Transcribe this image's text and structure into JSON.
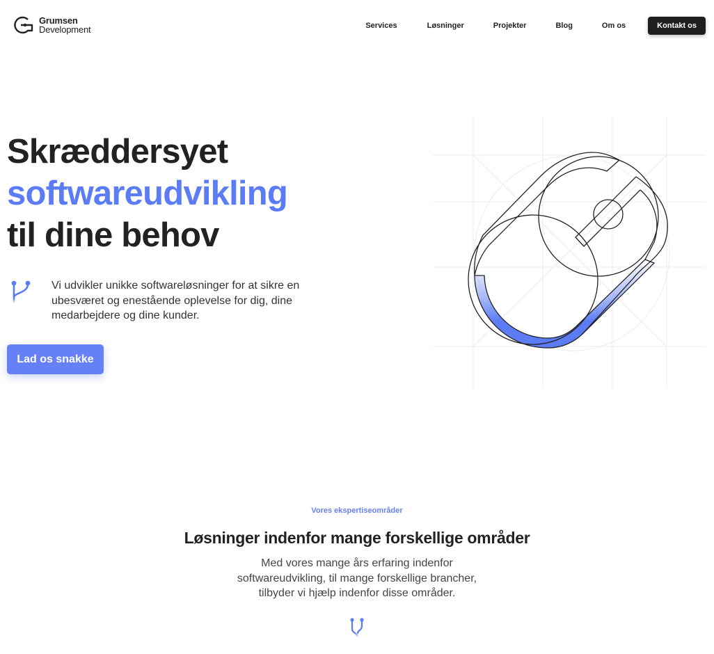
{
  "brand": {
    "line1": "Grumsen",
    "line2": "Development",
    "accent": "#5b7cf5"
  },
  "nav": {
    "items": [
      "Services",
      "Løsninger",
      "Projekter",
      "Blog",
      "Om os"
    ],
    "cta": "Kontakt os"
  },
  "hero": {
    "title_line1": "Skræddersyet",
    "title_line2": "softwareudvikling",
    "title_line3": "til dine behov",
    "description": "Vi udvikler unikke softwareløsninger for at sikre en ubesværet og enestående oplevelse for dig, dine medarbejdere og dine kunder.",
    "button": "Lad os snakke",
    "icon": "branch-icon",
    "illustration": "logo-construction-illustration"
  },
  "section": {
    "eyebrow": "Vores ekspertiseområder",
    "title": "Løsninger indenfor mange forskellige områder",
    "description": "Med vores mange års erfaring indenfor softwareudvikling, til mange forskellige brancher, tilbyder vi hjælp indenfor disse områder.",
    "icon": "branch-icon"
  }
}
